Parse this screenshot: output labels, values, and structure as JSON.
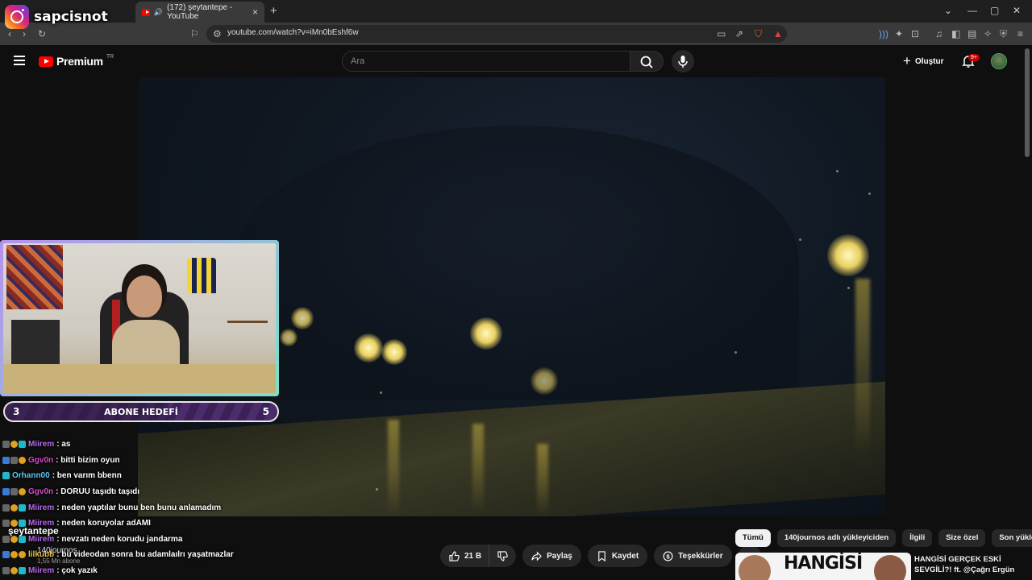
{
  "overlay": {
    "instagram_handle": "sapcisnot",
    "goal": {
      "title": "ABONE HEDEFİ",
      "current": "3",
      "target": "5",
      "progress": 0.6
    }
  },
  "browser": {
    "tab_title": "(172) şeytantepe - YouTube",
    "url": "youtube.com/watch?v=iMn0bEshf6w"
  },
  "youtube": {
    "brand": "Premium",
    "brand_region": "TR",
    "search_placeholder": "Ara",
    "create_label": "Oluştur",
    "notif_count": "9+"
  },
  "video": {
    "channel_title": "şeytantepe",
    "channel_name": "140journos",
    "subscribers": "1,55 Mn abone"
  },
  "actions": {
    "like_count": "21 B",
    "share": "Paylaş",
    "save": "Kaydet",
    "thanks": "Teşekkürler",
    "more": "•••"
  },
  "chips": [
    "Tümü",
    "140journos adlı yükleyiciden",
    "İlgili",
    "Size özel",
    "Son yüklenen"
  ],
  "recommendation": {
    "thumb_text": "HANGİSİ",
    "title": "HANGİSİ GERÇEK ESKİ SEVGİLİ?! ft. @Çağrı Ergün"
  },
  "chat": [
    {
      "user": "Miirem",
      "color": "#b86ae8",
      "text": ": as"
    },
    {
      "user": "Ggv0n",
      "color": "#d84ad0",
      "text": ": bitti bizim oyun"
    },
    {
      "user": "Orhann00",
      "color": "#5ac8f0",
      "text": ": ben varım bbenn"
    },
    {
      "user": "Ggv0n",
      "color": "#d84ad0",
      "text": ": DORUU taşıdtı taşıdı"
    },
    {
      "user": "Miirem",
      "color": "#b86ae8",
      "text": ": neden yaptılar bunu ben bunu anlamadım"
    },
    {
      "user": "Miirem",
      "color": "#b86ae8",
      "text": ": neden koruyolar adAMI"
    },
    {
      "user": "Miirem",
      "color": "#b86ae8",
      "text": ": nevzatı neden korudu jandarma"
    },
    {
      "user": "lilkubb",
      "color": "#e8c040",
      "text": ": bu videodan sonra bu adamlaılrı yaşatmazlar"
    },
    {
      "user": "Miirem",
      "color": "#b86ae8",
      "text": ": çok yazık"
    }
  ]
}
